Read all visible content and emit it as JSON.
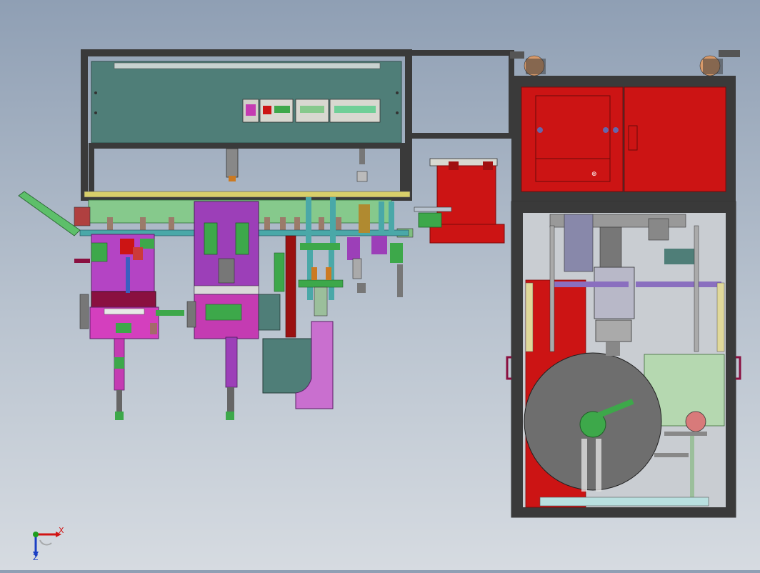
{
  "viewport": {
    "background_top": "#8f9fb4",
    "background_bottom": "#d6dbe1"
  },
  "colors": {
    "frame": "#3a3a3a",
    "teal_panel": "#4f7e78",
    "magenta": "#c43bb2",
    "purple": "#9c3fb8",
    "green": "#3da84a",
    "light_green": "#86c98c",
    "red": "#cc1414",
    "dark_red": "#a01010",
    "gray_disc": "#6e6e6e",
    "cabinet_fill": "#c9cdd2",
    "light_cyan": "#b9e0e0",
    "yellow_strip": "#d8cf6a"
  },
  "triad": {
    "x_label": "X",
    "z_label": "Z",
    "x_color": "#d11414",
    "y_color": "#1e9e1e",
    "z_color": "#1a3fc4"
  }
}
